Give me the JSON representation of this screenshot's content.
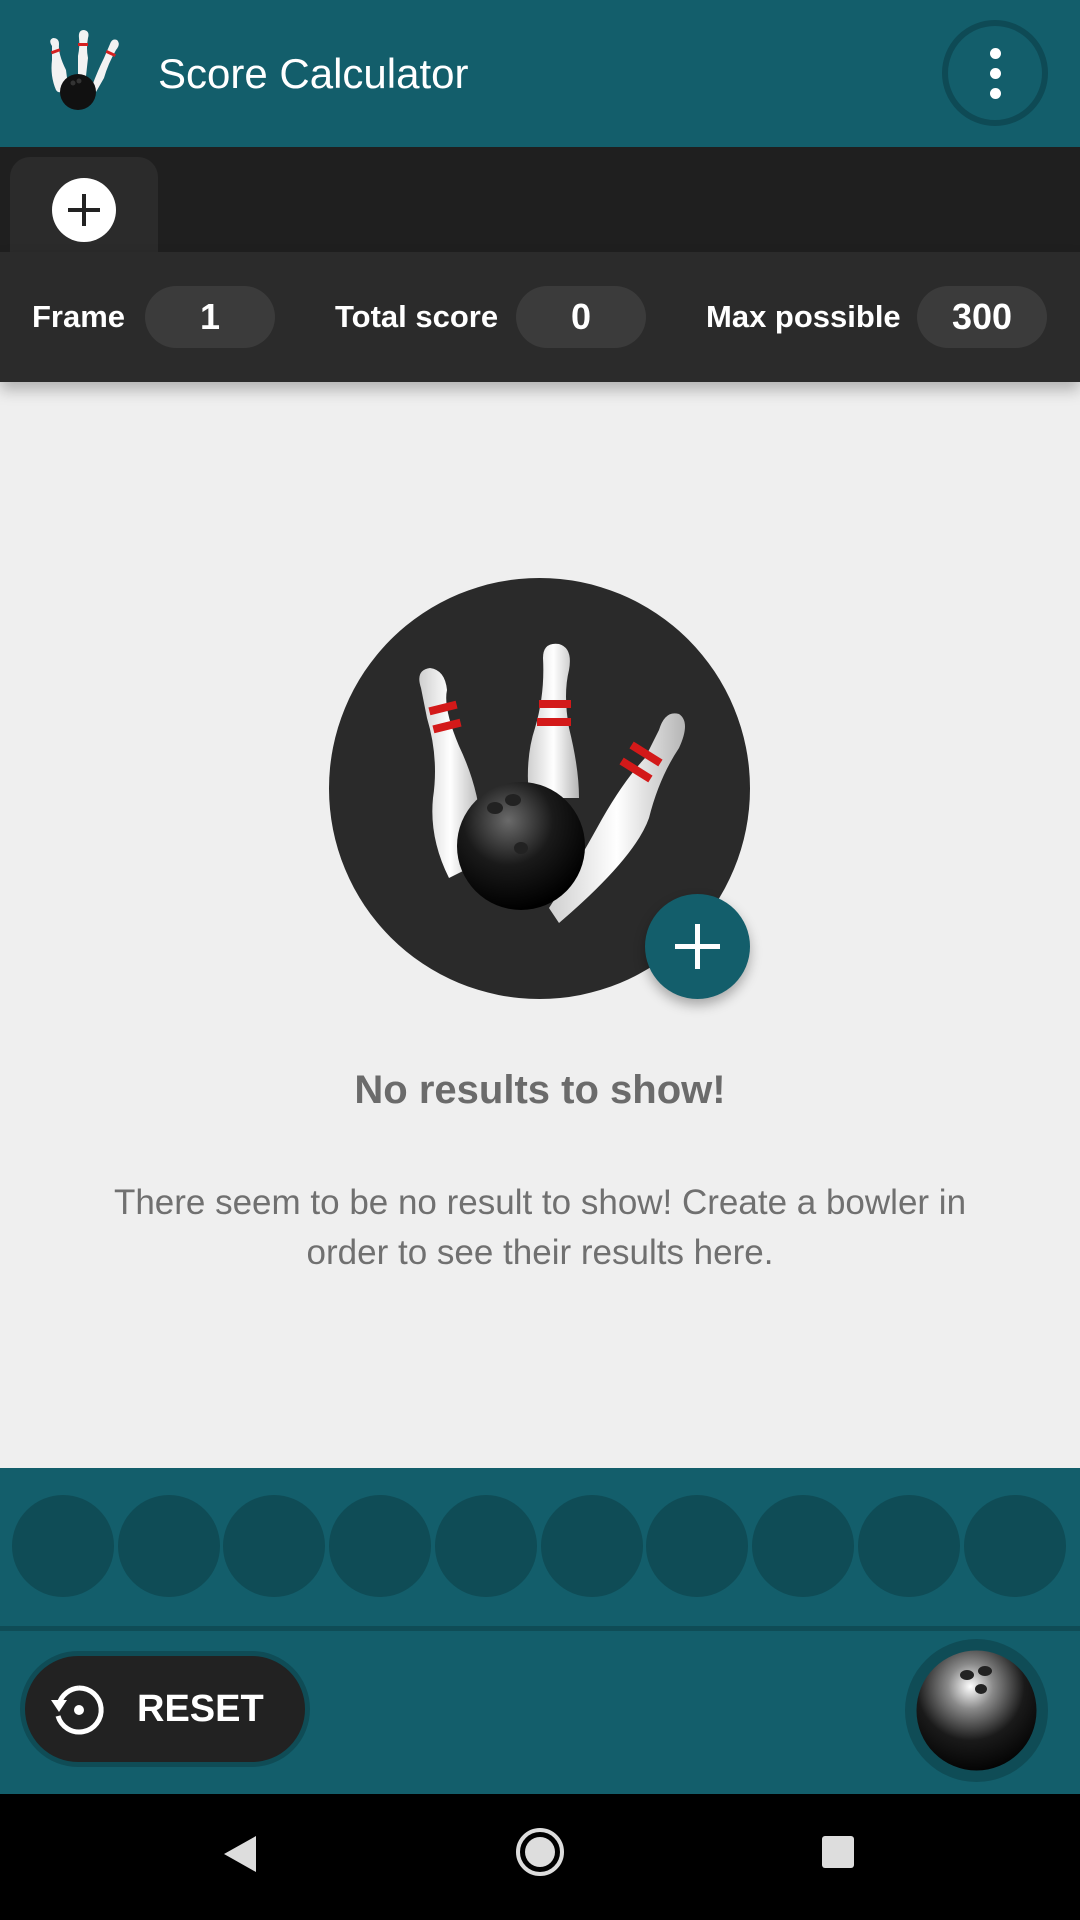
{
  "app_bar": {
    "title": "Score Calculator",
    "logo_icon": "bowling-logo-icon",
    "menu_icon": "more-vert-icon"
  },
  "tabs": {
    "add_icon": "add-icon"
  },
  "stats": {
    "frame_label": "Frame",
    "frame_value": "1",
    "total_label": "Total score",
    "total_value": "0",
    "max_label": "Max possible",
    "max_value": "300"
  },
  "empty_state": {
    "illustration_icon": "bowling-pins-icon",
    "add_icon": "add-icon",
    "title": "No results to show!",
    "message": "There seem to be no result to show! Create a bowler in order to see their results here."
  },
  "pins_row": {
    "count": 10
  },
  "bottom_bar": {
    "reset_label": "RESET",
    "reset_icon": "restore-icon",
    "ball_icon": "bowling-ball-icon"
  },
  "nav": {
    "back_icon": "back-triangle-icon",
    "home_icon": "home-circle-icon",
    "recents_icon": "recents-square-icon"
  },
  "colors": {
    "primary": "#135e6b",
    "primary_dark": "#0f4c56",
    "surface_dark": "#2b2b2b",
    "background": "#efefef"
  }
}
